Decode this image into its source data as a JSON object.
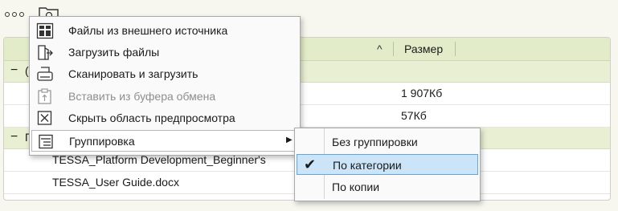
{
  "toolbar": {
    "more_icon": "ellipsis-icon",
    "folder_icon": "folder-icon"
  },
  "grid": {
    "sort_indicator": "^",
    "columns": {
      "size": "Размер"
    },
    "groups": [
      {
        "toggle": "−",
        "caption": "("
      },
      {
        "toggle": "−",
        "caption": "П"
      }
    ],
    "rows": [
      {
        "name": "",
        "size": "1 907Кб"
      },
      {
        "name": "",
        "size": "57Кб"
      },
      {
        "name": "TESSA_Platform Development_Beginner's",
        "size": ""
      },
      {
        "name": "TESSA_User Guide.docx",
        "size": ""
      }
    ]
  },
  "context_menu": {
    "items": [
      {
        "label": "Файлы из внешнего источника",
        "icon": "external-files-icon",
        "enabled": true
      },
      {
        "label": "Загрузить файлы",
        "icon": "upload-icon",
        "enabled": true
      },
      {
        "label": "Сканировать и загрузить",
        "icon": "scanner-icon",
        "enabled": true
      },
      {
        "label": "Вставить из буфера обмена",
        "icon": "paste-icon",
        "enabled": false
      },
      {
        "label": "Скрыть область предпросмотра",
        "icon": "close-box-icon",
        "enabled": true
      },
      {
        "label": "Группировка",
        "icon": "grouping-icon",
        "enabled": true,
        "submenu_arrow": "▶"
      }
    ]
  },
  "grouping_submenu": {
    "check_mark": "✔",
    "items": [
      {
        "label": "Без группировки",
        "selected": false
      },
      {
        "label": "По категории",
        "selected": true
      },
      {
        "label": "По копии",
        "selected": false
      }
    ]
  }
}
